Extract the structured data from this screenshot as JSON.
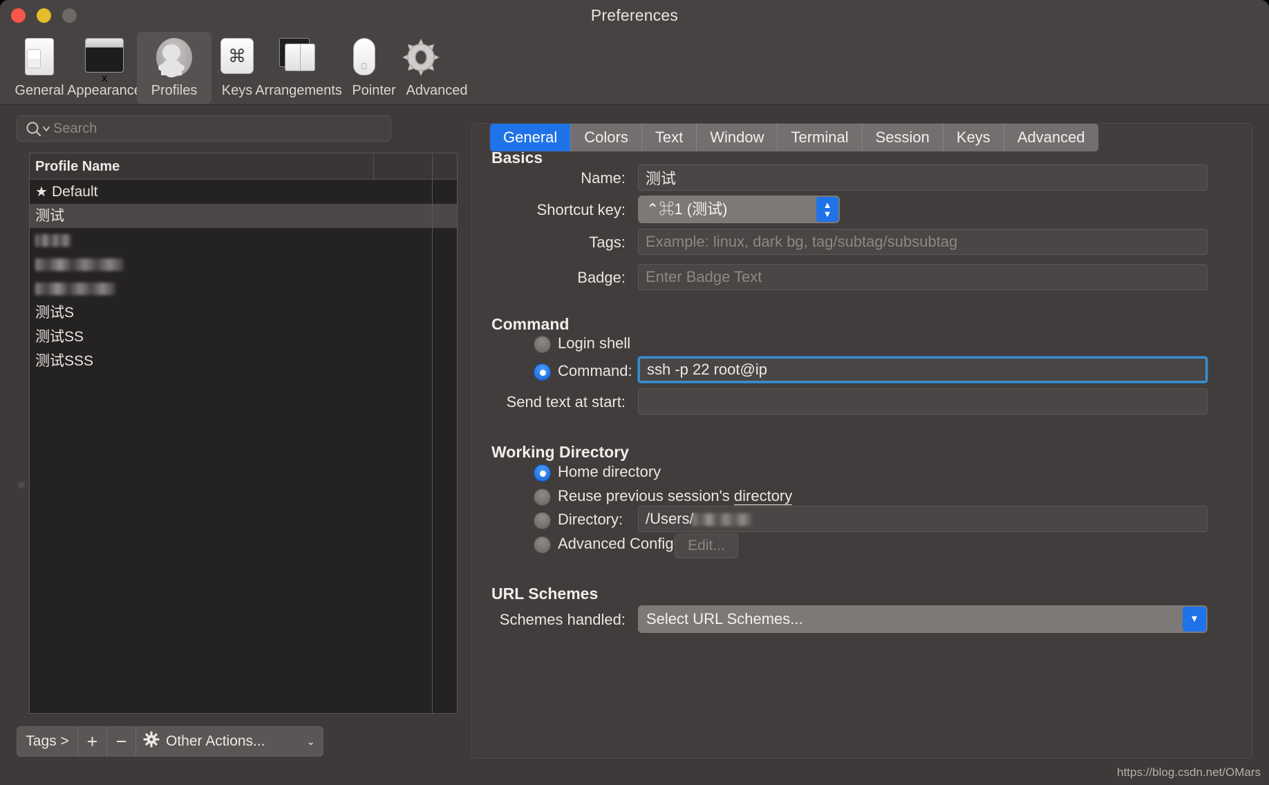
{
  "window": {
    "title": "Preferences",
    "traffic_lights": [
      "close",
      "minimize",
      "zoom"
    ]
  },
  "toolbar": {
    "items": [
      {
        "label": "General",
        "icon": "general-icon",
        "selected": false
      },
      {
        "label": "Appearance",
        "icon": "appearance-icon",
        "selected": false
      },
      {
        "label": "Profiles",
        "icon": "profiles-icon",
        "selected": true
      },
      {
        "label": "Keys",
        "icon": "keys-icon",
        "selected": false
      },
      {
        "label": "Arrangements",
        "icon": "arrangements-icon",
        "selected": false
      },
      {
        "label": "Pointer",
        "icon": "pointer-icon",
        "selected": false
      },
      {
        "label": "Advanced",
        "icon": "advanced-gear-icon",
        "selected": false
      }
    ]
  },
  "sidebar": {
    "search": {
      "placeholder": "Search",
      "value": "",
      "icon": "search-icon"
    },
    "list": {
      "column_header": "Profile Name",
      "rows": [
        {
          "label": "Default",
          "star": "★",
          "redacted": false,
          "selected": false
        },
        {
          "label": "测试",
          "star": "",
          "redacted": false,
          "selected": true
        },
        {
          "label": "",
          "star": "",
          "redacted": true,
          "selected": false,
          "blur_width": 52
        },
        {
          "label": "",
          "star": "",
          "redacted": true,
          "selected": false,
          "blur_width": 128
        },
        {
          "label": "",
          "star": "",
          "redacted": true,
          "selected": false,
          "blur_width": 116
        },
        {
          "label": "测试S",
          "star": "",
          "redacted": false,
          "selected": false
        },
        {
          "label": "测试SS",
          "star": "",
          "redacted": false,
          "selected": false
        },
        {
          "label": "测试SSS",
          "star": "",
          "redacted": false,
          "selected": false
        }
      ]
    },
    "bottom_bar": {
      "tags_label": "Tags >",
      "add_label": "+",
      "remove_label": "−",
      "other_actions_label": "Other Actions...",
      "other_actions_icon": "gear-icon",
      "chevron": "⌄"
    }
  },
  "tabs": [
    {
      "label": "General",
      "active": true
    },
    {
      "label": "Colors",
      "active": false
    },
    {
      "label": "Text",
      "active": false
    },
    {
      "label": "Window",
      "active": false
    },
    {
      "label": "Terminal",
      "active": false
    },
    {
      "label": "Session",
      "active": false
    },
    {
      "label": "Keys",
      "active": false
    },
    {
      "label": "Advanced",
      "active": false
    }
  ],
  "basics": {
    "heading": "Basics",
    "name_label": "Name:",
    "name_value": "测试",
    "shortcut_label": "Shortcut key:",
    "shortcut_value": "⌃⌘1 (测试)",
    "tags_label": "Tags:",
    "tags_value": "",
    "tags_placeholder": "Example: linux, dark bg, tag/subtag/subsubtag",
    "badge_label": "Badge:",
    "badge_value": "",
    "badge_placeholder": "Enter Badge Text"
  },
  "command": {
    "heading": "Command",
    "login_shell_label": "Login shell",
    "login_shell_selected": false,
    "command_label": "Command:",
    "command_selected": true,
    "command_value": "ssh -p 22 root@ip",
    "send_text_label": "Send text at start:",
    "send_text_value": ""
  },
  "working_directory": {
    "heading": "Working Directory",
    "home_label": "Home directory",
    "home_selected": true,
    "reuse_label_pre": "Reuse previous session's ",
    "reuse_label_underlined": "directory",
    "reuse_selected": false,
    "directory_label": "Directory:",
    "directory_selected": false,
    "directory_value": "/Users/",
    "advanced_label": "Advanced Configuration",
    "advanced_selected": false,
    "edit_button_label": "Edit..."
  },
  "url_schemes": {
    "heading": "URL Schemes",
    "schemes_label": "Schemes handled:",
    "schemes_value": "Select URL Schemes..."
  },
  "watermark": "https://blog.csdn.net/OMars",
  "colors": {
    "accent_blue": "#1f72e8",
    "window_bg": "#3e3a39",
    "panel_bg": "#413d3c",
    "list_bg": "#252222",
    "tab_inactive": "#736f6e",
    "focus_ring": "#3d8ecb"
  }
}
